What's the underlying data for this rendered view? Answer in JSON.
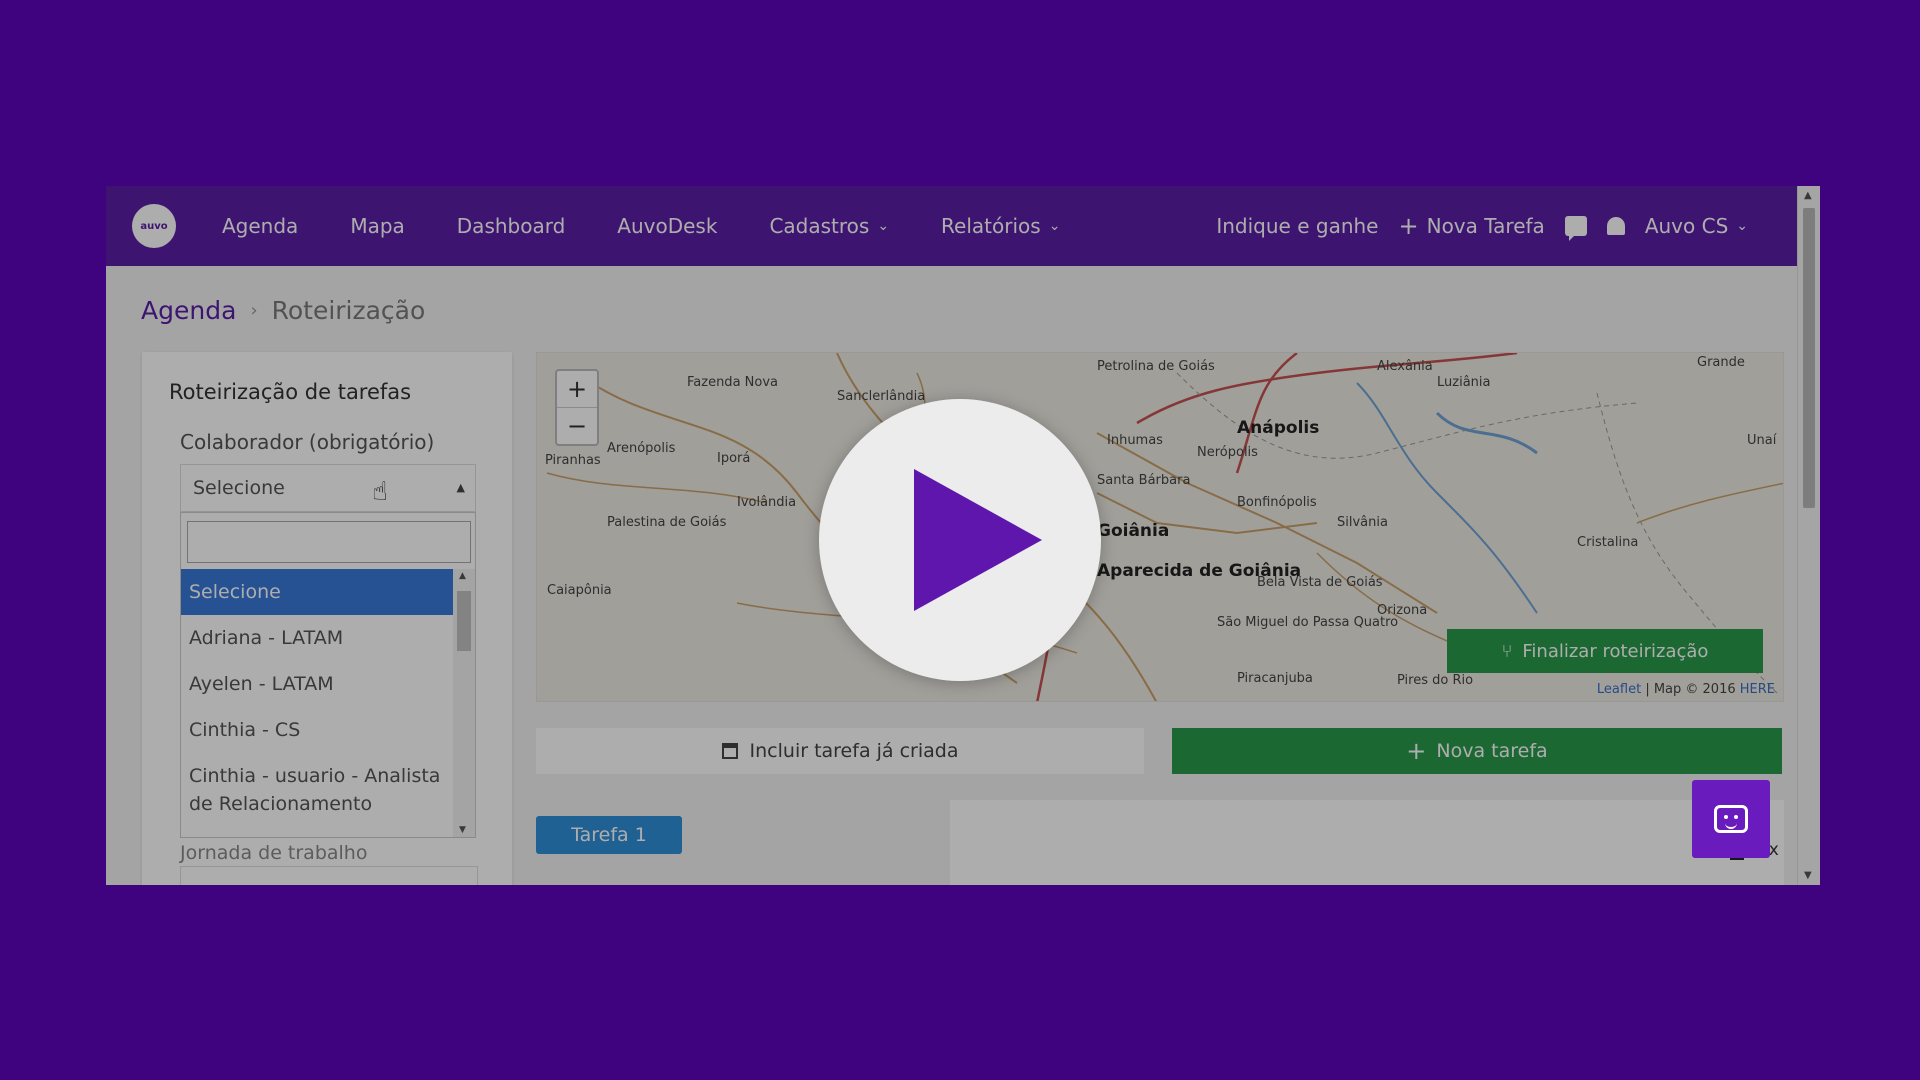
{
  "nav": {
    "logo_text": "auvo",
    "items": [
      {
        "label": "Agenda"
      },
      {
        "label": "Mapa"
      },
      {
        "label": "Dashboard"
      },
      {
        "label": "AuvoDesk"
      },
      {
        "label": "Cadastros"
      },
      {
        "label": "Relatórios"
      }
    ],
    "refer": "Indique e ganhe",
    "new_task": "Nova Tarefa",
    "user": "Auvo CS"
  },
  "breadcrumb": {
    "root": "Agenda",
    "current": "Roteirização"
  },
  "routing_panel": {
    "title": "Roteirização de tarefas",
    "collaborator_label": "Colaborador (obrigatório)",
    "select_value": "Selecione",
    "search_value": "",
    "options": [
      "Selecione",
      "Adriana - LATAM",
      "Ayelen - LATAM",
      "Cinthia - CS",
      "Cinthia - usuario - Analista de Relacionamento"
    ],
    "under_text": "Jornada de trabalho"
  },
  "map": {
    "zoom_in": "+",
    "zoom_out": "−",
    "finalize_button": "Finalizar roteirização",
    "attribution_link1": "Leaflet",
    "attribution_mid": " | Map © 2016 ",
    "attribution_link2": "HERE",
    "cities": [
      {
        "name": "Anápolis"
      },
      {
        "name": "Goiânia"
      },
      {
        "name": "Aparecida de Goiânia"
      },
      {
        "name": "Luziânia"
      },
      {
        "name": "Cristalina"
      },
      {
        "name": "Petrolina de Goiás"
      },
      {
        "name": "Inhumas"
      },
      {
        "name": "Nerópolis"
      },
      {
        "name": "Bonfinópolis"
      },
      {
        "name": "Silvânia"
      },
      {
        "name": "Bela Vista de Goiás"
      },
      {
        "name": "São Miguel do Passa Quatro"
      },
      {
        "name": "Piracanjuba"
      },
      {
        "name": "Pires do Rio"
      },
      {
        "name": "Orizona"
      },
      {
        "name": "Fazenda Nova"
      },
      {
        "name": "Sanclerlândia"
      },
      {
        "name": "Piranhas"
      },
      {
        "name": "Arenópolis"
      },
      {
        "name": "Iporá"
      },
      {
        "name": "Ivolândia"
      },
      {
        "name": "Palestina de Goiás"
      },
      {
        "name": "Caiapônia"
      },
      {
        "name": "Alexânia"
      },
      {
        "name": "Grande"
      },
      {
        "name": "Unaí"
      },
      {
        "name": "Santa Bárbara"
      }
    ]
  },
  "actions": {
    "include_task": "Incluir tarefa já criada",
    "new_task": "Nova tarefa"
  },
  "task_tabs": {
    "tab1": "Tarefa 1",
    "delete_label": "Ex"
  },
  "colors": {
    "background": "#3f0380",
    "nav": "#5a1fa6",
    "green": "#2a9a4a",
    "blue_tab": "#2f8fd8",
    "play_triangle": "#5e16ad"
  }
}
